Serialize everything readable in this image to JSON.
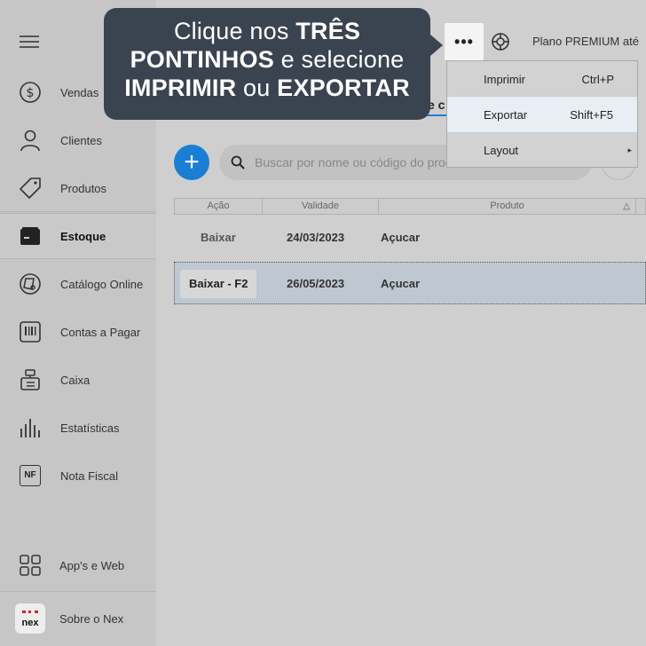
{
  "sidebar": {
    "items": [
      {
        "label": "Vendas",
        "icon": "dollar-circle-icon"
      },
      {
        "label": "Clientes",
        "icon": "person-icon"
      },
      {
        "label": "Produtos",
        "icon": "tag-icon"
      },
      {
        "label": "Estoque",
        "icon": "box-icon",
        "active": true
      },
      {
        "label": "Catálogo Online",
        "icon": "catalog-icon"
      },
      {
        "label": "Contas a Pagar",
        "icon": "barcode-icon"
      },
      {
        "label": "Caixa",
        "icon": "cash-register-icon"
      },
      {
        "label": "Estatísticas",
        "icon": "bar-chart-icon"
      },
      {
        "label": "Nota Fiscal",
        "icon": "nf-icon",
        "icon_text": "NF"
      }
    ],
    "bottom_items": [
      {
        "label": "App's e Web",
        "icon": "apps-grid-icon"
      },
      {
        "label": "Sobre o Nex",
        "icon": "nex-logo-icon",
        "logo_text": "nex"
      }
    ]
  },
  "tooltip": {
    "line1_pre": "Clique nos ",
    "line1_bold": "TRÊS",
    "line2_bold": "PONTINHOS",
    "line2_post": " e selecione",
    "line3_bold1": "IMPRIMIR",
    "line3_mid": " ou ",
    "line3_bold2": "EXPORTAR"
  },
  "header": {
    "more_label": "•••",
    "plan_text": "Plano PREMIUM até",
    "tab_fragment": "e c"
  },
  "menu": {
    "items": [
      {
        "label": "Imprimir",
        "shortcut": "Ctrl+P"
      },
      {
        "label": "Exportar",
        "shortcut": "Shift+F5",
        "highlighted": true
      },
      {
        "label": "Layout",
        "shortcut": "",
        "submenu_arrow": "▸"
      }
    ]
  },
  "toolbar": {
    "add_label": "+",
    "search_placeholder": "Buscar por nome ou código do produto"
  },
  "table": {
    "columns": [
      "Ação",
      "Validade",
      "Produto"
    ],
    "sort_indicator": "△",
    "rows": [
      {
        "action": "Baixar",
        "validade": "24/03/2023",
        "produto": "Açucar",
        "selected": false
      },
      {
        "action": "Baixar - F2",
        "validade": "26/05/2023",
        "produto": "Açucar",
        "selected": true
      }
    ]
  },
  "colors": {
    "tooltip_bg": "#3a4350",
    "accent_blue": "#1a7fd4",
    "selected_row": "#bfc8d0",
    "nex_red": "#d9232e"
  }
}
